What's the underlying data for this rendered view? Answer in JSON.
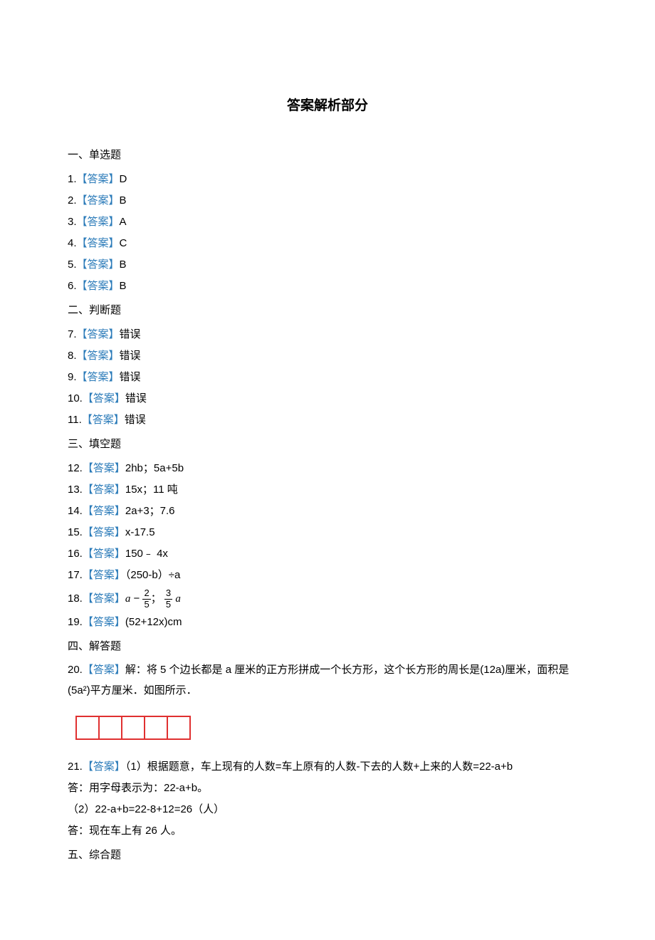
{
  "title": "答案解析部分",
  "sections": {
    "s1": {
      "header": "一、单选题"
    },
    "s2": {
      "header": "二、判断题"
    },
    "s3": {
      "header": "三、填空题"
    },
    "s4": {
      "header": "四、解答题"
    },
    "s5": {
      "header": "五、综合题"
    }
  },
  "answer_label": "【答案】",
  "answers": {
    "q1": {
      "n": "1.",
      "v": "D"
    },
    "q2": {
      "n": "2.",
      "v": "B"
    },
    "q3": {
      "n": "3.",
      "v": "A"
    },
    "q4": {
      "n": "4.",
      "v": "C"
    },
    "q5": {
      "n": "5.",
      "v": "B"
    },
    "q6": {
      "n": "6.",
      "v": "B"
    },
    "q7": {
      "n": "7.",
      "v": "错误"
    },
    "q8": {
      "n": "8.",
      "v": "错误"
    },
    "q9": {
      "n": "9.",
      "v": "错误"
    },
    "q10": {
      "n": "10.",
      "v": "错误"
    },
    "q11": {
      "n": "11.",
      "v": "错误"
    },
    "q12": {
      "n": "12.",
      "v": "2hb；5a+5b"
    },
    "q13": {
      "n": "13.",
      "v": "15x；11 吨"
    },
    "q14": {
      "n": "14.",
      "v": "2a+3；7.6"
    },
    "q15": {
      "n": "15.",
      "v": "x-17.5"
    },
    "q16": {
      "n": "16.",
      "v": "150﹣ 4x"
    },
    "q17": {
      "n": "17.",
      "v": "（250-b）÷a"
    },
    "q18": {
      "n": "18.",
      "a_var": "a",
      "minus": " − ",
      "f1_num": "2",
      "f1_den": "5",
      "sep": "；",
      "f2_num": "3",
      "f2_den": "5",
      "a_var2": "a"
    },
    "q19": {
      "n": "19.",
      "v": "(52+12x)cm"
    },
    "q20": {
      "n": "20.",
      "text1": "解：将 5 个边长都是 a 厘米的正方形拼成一个长方形，这个长方形的周长是(12a)厘米，面积是",
      "text2": "(5a²)平方厘米．如图所示．"
    },
    "q21": {
      "n": "21.",
      "line1": "（1）根据题意，车上现有的人数=车上原有的人数-下去的人数+上来的人数=22-a+b",
      "line2": "答：用字母表示为：22-a+b。",
      "line3": "（2）22-a+b=22-8+12=26（人）",
      "line4": "答：现在车上有 26 人。"
    }
  }
}
